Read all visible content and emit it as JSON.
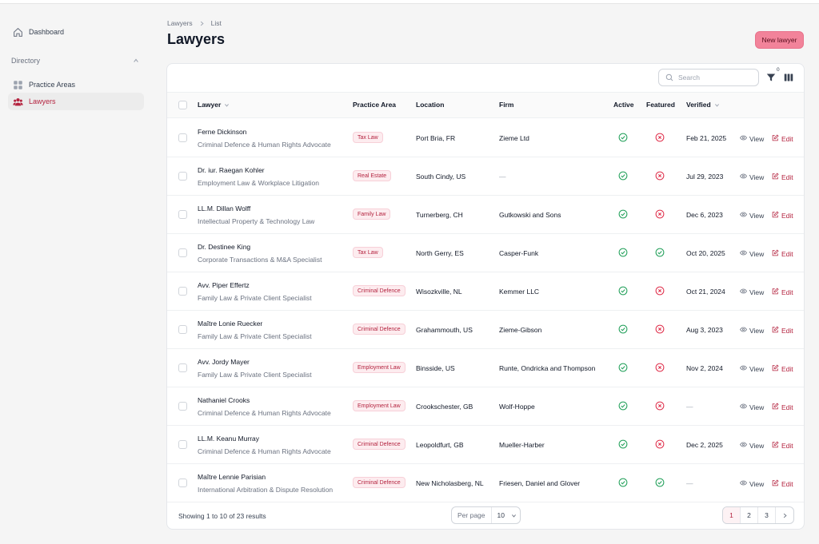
{
  "sidebar": {
    "dashboard": "Dashboard",
    "group": "Directory",
    "practice_areas": "Practice Areas",
    "lawyers": "Lawyers"
  },
  "header": {
    "breadcrumb": [
      "Lawyers",
      "List"
    ],
    "title": "Lawyers",
    "new_button": "New lawyer"
  },
  "toolbar": {
    "search_placeholder": "Search",
    "filter_count": "0"
  },
  "columns": {
    "lawyer": "Lawyer",
    "practice_area": "Practice Area",
    "location": "Location",
    "firm": "Firm",
    "active": "Active",
    "featured": "Featured",
    "verified": "Verified"
  },
  "actions": {
    "view": "View",
    "edit": "Edit"
  },
  "rows": [
    {
      "name": "Ferne Dickinson",
      "desc": "Criminal Defence & Human Rights Advocate",
      "area": "Tax Law",
      "location": "Port Bria, FR",
      "firm": "Zieme Ltd",
      "active": true,
      "featured": false,
      "verified": "Feb 21, 2025"
    },
    {
      "name": "Dr. iur. Raegan Kohler",
      "desc": "Employment Law & Workplace Litigation",
      "area": "Real Estate",
      "location": "South Cindy, US",
      "firm": "—",
      "active": true,
      "featured": false,
      "verified": "Jul 29, 2023"
    },
    {
      "name": "LL.M. Dillan Wolff",
      "desc": "Intellectual Property & Technology Law",
      "area": "Family Law",
      "location": "Turnerberg, CH",
      "firm": "Gutkowski and Sons",
      "active": true,
      "featured": false,
      "verified": "Dec 6, 2023"
    },
    {
      "name": "Dr. Destinee King",
      "desc": "Corporate Transactions & M&A Specialist",
      "area": "Tax Law",
      "location": "North Gerry, ES",
      "firm": "Casper-Funk",
      "active": true,
      "featured": true,
      "verified": "Oct 20, 2025"
    },
    {
      "name": "Avv. Piper Effertz",
      "desc": "Family Law & Private Client Specialist",
      "area": "Criminal Defence",
      "location": "Wisozkville, NL",
      "firm": "Kemmer LLC",
      "active": true,
      "featured": false,
      "verified": "Oct 21, 2024"
    },
    {
      "name": "Maître Lonie Ruecker",
      "desc": "Family Law & Private Client Specialist",
      "area": "Criminal Defence",
      "location": "Grahammouth, US",
      "firm": "Zieme-Gibson",
      "active": true,
      "featured": false,
      "verified": "Aug 3, 2023"
    },
    {
      "name": "Avv. Jordy Mayer",
      "desc": "Family Law & Private Client Specialist",
      "area": "Employment Law",
      "location": "Binsside, US",
      "firm": "Runte, Ondricka and Thompson",
      "active": true,
      "featured": false,
      "verified": "Nov 2, 2024"
    },
    {
      "name": "Nathaniel Crooks",
      "desc": "Criminal Defence & Human Rights Advocate",
      "area": "Employment Law",
      "location": "Crookschester, GB",
      "firm": "Wolf-Hoppe",
      "active": true,
      "featured": false,
      "verified": "—"
    },
    {
      "name": "LL.M. Keanu Murray",
      "desc": "Criminal Defence & Human Rights Advocate",
      "area": "Criminal Defence",
      "location": "Leopoldfurt, GB",
      "firm": "Mueller-Harber",
      "active": true,
      "featured": false,
      "verified": "Dec 2, 2025"
    },
    {
      "name": "Maître Lennie Parisian",
      "desc": "International Arbitration & Dispute Resolution",
      "area": "Criminal Defence",
      "location": "New Nicholasberg, NL",
      "firm": "Friesen, Daniel and Glover",
      "active": true,
      "featured": true,
      "verified": "—"
    }
  ],
  "footer": {
    "showing": "Showing 1 to 10 of 23 results",
    "per_page_label": "Per page",
    "per_page_value": "10",
    "pages": [
      "1",
      "2",
      "3"
    ],
    "current_page": "1"
  },
  "colors": {
    "accent": "#b4233f",
    "button": "#f2839a",
    "success": "#22a05a",
    "danger": "#e0324e"
  }
}
